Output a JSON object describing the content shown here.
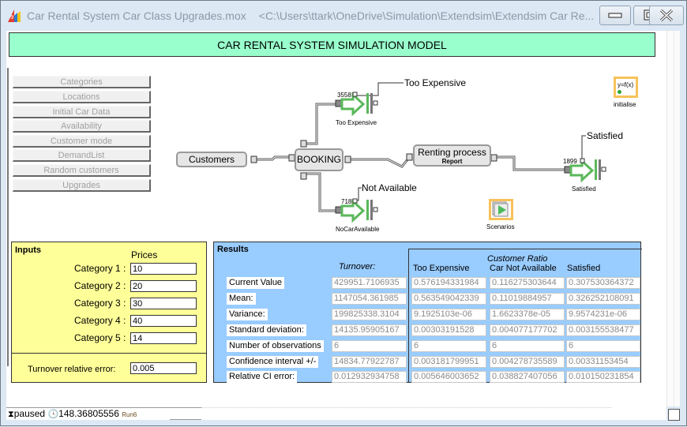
{
  "window": {
    "title": "Car Rental System Car Class Upgrades.mox",
    "path": "<C:\\Users\\ttark\\OneDrive\\Simulation\\Extendsim\\Extendsim Car Re...",
    "minimize_icon": "minimize-icon",
    "maximize_icon": "maximize-icon",
    "close_icon": "close-icon"
  },
  "header": {
    "title": "CAR RENTAL SYSTEM SIMULATION MODEL"
  },
  "nav_buttons": [
    {
      "label": "Categories"
    },
    {
      "label": "Locations"
    },
    {
      "label": "Initial Car Data"
    },
    {
      "label": "Availability"
    },
    {
      "label": "Customer mode"
    },
    {
      "label": "DemandList"
    },
    {
      "label": "Random customers"
    },
    {
      "label": "Upgrades"
    }
  ],
  "diagram": {
    "customers": "Customers",
    "booking": "BOOKING",
    "renting": "Renting process",
    "renting_sub": "Report",
    "exits": {
      "too_expensive": {
        "count": "3558",
        "label": "Too Expensive",
        "tag": "Too Expensive"
      },
      "not_available": {
        "count": "718",
        "label": "NoCarAvailable",
        "tag": "Not Available"
      },
      "satisfied": {
        "count": "1899",
        "label": "Satisfied",
        "tag": "Satisfied"
      }
    },
    "equation_block": {
      "text": "y=f(x)",
      "label": "initialise"
    },
    "scenarios_block": {
      "label": "Scenarios"
    }
  },
  "inputs": {
    "title": "Inputs",
    "prices_header": "Prices",
    "categories": [
      {
        "label": "Category 1 :",
        "value": "10"
      },
      {
        "label": "Category 2 :",
        "value": "20"
      },
      {
        "label": "Category 3 :",
        "value": "30"
      },
      {
        "label": "Category 4 :",
        "value": "40"
      },
      {
        "label": "Category 5 :",
        "value": "14"
      }
    ],
    "turnover_error_label": "Turnover relative error:",
    "turnover_error_value": "0.005"
  },
  "results": {
    "title": "Results",
    "turnover_header": "Turnover:",
    "ratio_header": "Customer Ratio",
    "columns": [
      "Too Expensive",
      "Car Not Available",
      "Satisfied"
    ],
    "rows": [
      {
        "label": "Current Value",
        "turnover": "429951.7106935",
        "values": [
          "0.576194331984",
          "0.116275303644",
          "0.307530364372"
        ]
      },
      {
        "label": "Mean:",
        "turnover": "1147054.361985",
        "values": [
          "0.563549042339",
          "0.11019884957",
          "0.326252108091"
        ]
      },
      {
        "label": "Variance:",
        "turnover": "199825338.3104",
        "values": [
          "9.1925103e-06",
          "1.6623378e-05",
          "9.9574231e-06"
        ]
      },
      {
        "label": "Standard deviation:",
        "turnover": "14135.95905167",
        "values": [
          "0.00303191528",
          "0.004077177702",
          "0.003155538477"
        ]
      },
      {
        "label": "Number of observations",
        "turnover": "6",
        "values": [
          "6",
          "6",
          "6"
        ]
      },
      {
        "label": "Confidence interval +/-",
        "turnover": "14834.77922787",
        "values": [
          "0.003181799951",
          "0.004278735589",
          "0.00331153454"
        ]
      },
      {
        "label": "Relative CI error:",
        "turnover": "0.012932934758",
        "values": [
          "0.005646003652",
          "0.038827407056",
          "0.010150231854"
        ]
      }
    ]
  },
  "status": {
    "state": "paused",
    "time": "148.36805556",
    "run": "Run6"
  }
}
